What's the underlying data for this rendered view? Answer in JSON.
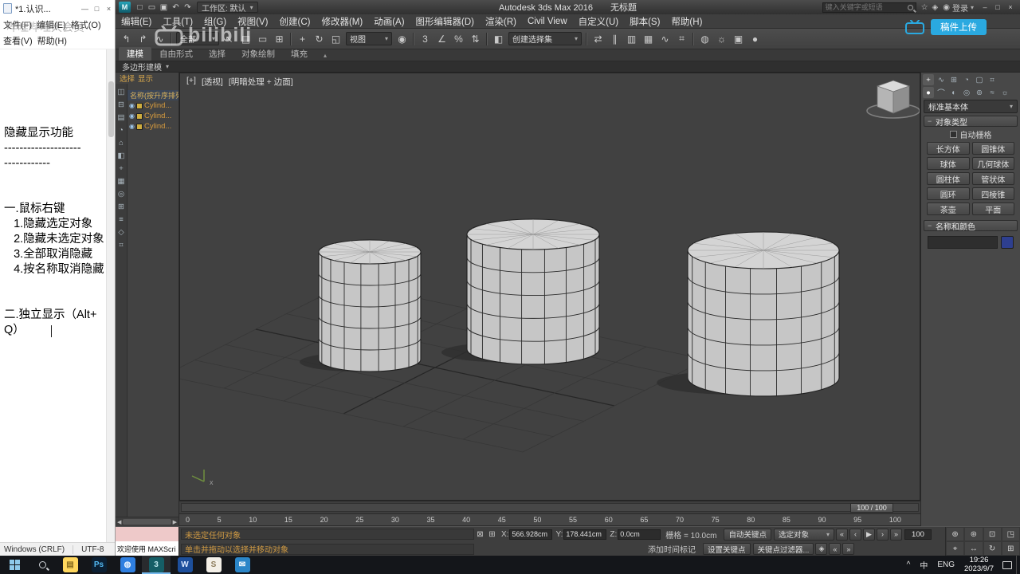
{
  "overlay": {
    "watermark_left": "哔哩哔哩大会员",
    "logo_text": "bilibili",
    "upload_label": "稿件上传",
    "brand_color": "#2aa9e0"
  },
  "notepad": {
    "title": "*1.认识...",
    "menus": [
      "文件(F)",
      "编辑(E)",
      "格式(O)",
      "查看(V)",
      "帮助(H)"
    ],
    "window_buttons": [
      {
        "n": "notepad-minimize-button",
        "g": "—"
      },
      {
        "n": "notepad-maximize-button",
        "g": "□"
      },
      {
        "n": "notepad-close-button",
        "g": "×"
      }
    ],
    "lines": [
      "",
      "",
      "隐藏显示功能",
      "--------------------",
      "------------",
      "",
      "",
      "一.鼠标右键",
      "   1.隐藏选定对象",
      "   2.隐藏未选定对象",
      "   3.全部取消隐藏",
      "   4.按名称取消隐藏",
      "",
      "",
      "二.独立显示（Alt+Q）"
    ],
    "status_left": "Windows (CRLF)",
    "status_right": "UTF-8"
  },
  "max": {
    "titlebar": {
      "workspace": "工作区: 默认",
      "app_title": "Autodesk 3ds Max 2016",
      "doc_title": "无标题",
      "search_placeholder": "键入关键字或短语",
      "signin": "登录",
      "quick_icons": [
        {
          "n": "new-file-icon",
          "g": "□"
        },
        {
          "n": "open-file-icon",
          "g": "▭"
        },
        {
          "n": "save-icon",
          "g": "▣"
        },
        {
          "n": "undo-icon",
          "g": "↶"
        },
        {
          "n": "redo-icon",
          "g": "↷"
        }
      ],
      "right_icons": [
        {
          "n": "favorites-star-icon",
          "g": "☆"
        },
        {
          "n": "infocenter-icon",
          "g": "◈"
        }
      ],
      "window_buttons": [
        {
          "n": "minimize-button",
          "g": "–"
        },
        {
          "n": "maximize-button",
          "g": "□"
        },
        {
          "n": "close-button",
          "g": "×"
        }
      ]
    },
    "menubar": [
      "编辑(E)",
      "工具(T)",
      "组(G)",
      "视图(V)",
      "创建(C)",
      "修改器(M)",
      "动画(A)",
      "图形编辑器(D)",
      "渲染(R)",
      "Civil View",
      "自定义(U)",
      "脚本(S)",
      "帮助(H)"
    ],
    "toolbar_items": [
      {
        "n": "select-link-icon",
        "g": "↰",
        "cls": "icon"
      },
      {
        "n": "unlink-icon",
        "g": "↱",
        "cls": "icon"
      },
      {
        "n": "bind-spacewarp-icon",
        "g": "∿",
        "cls": "icon"
      },
      {
        "n": "toolbar-separator",
        "cls": "sep"
      },
      {
        "n": "selection-filter-dropdown",
        "v": "全部",
        "cls": "drop d1"
      },
      {
        "n": "select-object-icon",
        "g": "↖",
        "cls": "icon"
      },
      {
        "n": "select-by-name-icon",
        "g": "▤",
        "cls": "icon"
      },
      {
        "n": "rect-region-icon",
        "g": "▭",
        "cls": "icon"
      },
      {
        "n": "window-crossing-icon",
        "g": "⊞",
        "cls": "icon"
      },
      {
        "n": "toolbar-separator",
        "cls": "sep"
      },
      {
        "n": "move-icon",
        "g": "+",
        "cls": "icon"
      },
      {
        "n": "rotate-icon",
        "g": "↻",
        "cls": "icon"
      },
      {
        "n": "scale-icon",
        "g": "◱",
        "cls": "icon"
      },
      {
        "n": "ref-coord-dropdown",
        "v": "视图",
        "cls": "drop d2"
      },
      {
        "n": "use-pivot-center-icon",
        "g": "◉",
        "cls": "icon"
      },
      {
        "n": "toolbar-separator",
        "cls": "sep"
      },
      {
        "n": "snap-toggle-icon",
        "g": "3",
        "cls": "icon"
      },
      {
        "n": "angle-snap-icon",
        "g": "∠",
        "cls": "icon"
      },
      {
        "n": "percent-snap-icon",
        "g": "%",
        "cls": "icon"
      },
      {
        "n": "spinner-snap-icon",
        "g": "⇅",
        "cls": "icon"
      },
      {
        "n": "toolbar-separator",
        "cls": "sep"
      },
      {
        "n": "edit-named-selections-icon",
        "g": "◧",
        "cls": "icon"
      },
      {
        "n": "named-selection-dropdown",
        "v": "创建选择集",
        "cls": "drop d3"
      },
      {
        "n": "toolbar-separator",
        "cls": "sep"
      },
      {
        "n": "mirror-icon",
        "g": "⇄",
        "cls": "icon"
      },
      {
        "n": "align-icon",
        "g": "∥",
        "cls": "icon"
      },
      {
        "n": "layer-manager-icon",
        "g": "▥",
        "cls": "icon"
      },
      {
        "n": "ribbon-toggle-icon",
        "g": "▦",
        "cls": "icon"
      },
      {
        "n": "curve-editor-icon",
        "g": "∿",
        "cls": "icon"
      },
      {
        "n": "schematic-view-icon",
        "g": "⌗",
        "cls": "icon"
      },
      {
        "n": "toolbar-separator",
        "cls": "sep"
      },
      {
        "n": "material-editor-icon",
        "g": "◍",
        "cls": "icon"
      },
      {
        "n": "render-setup-icon",
        "g": "☼",
        "cls": "icon"
      },
      {
        "n": "rendered-frame-icon",
        "g": "▣",
        "cls": "icon"
      },
      {
        "n": "render-production-icon",
        "g": "●",
        "cls": "icon"
      }
    ],
    "ribbon": {
      "tabs": [
        {
          "label": "建模",
          "active": true
        },
        {
          "label": "自由形式"
        },
        {
          "label": "选择"
        },
        {
          "label": "对象绘制"
        },
        {
          "label": "填充"
        }
      ],
      "subtab": "多边形建模"
    },
    "explorer": {
      "menu_select": "选择",
      "menu_display": "显示",
      "header": "名称(按升序排列)",
      "tools": [
        {
          "n": "explorer-pin-icon",
          "g": "◫"
        },
        {
          "n": "explorer-sort-icon",
          "g": "⊟"
        },
        {
          "n": "explorer-list-icon",
          "g": "▤"
        },
        {
          "n": "explorer-time-icon",
          "g": "◔"
        },
        {
          "n": "explorer-home-icon",
          "g": "⌂"
        },
        {
          "n": "explorer-filter-icon",
          "g": "◧"
        },
        {
          "n": "explorer-add-icon",
          "g": "+"
        },
        {
          "n": "explorer-grid-icon",
          "g": "▦"
        },
        {
          "n": "explorer-target-icon",
          "g": "◎"
        },
        {
          "n": "explorer-box-icon",
          "g": "⊞"
        },
        {
          "n": "explorer-rows-icon",
          "g": "≡"
        },
        {
          "n": "explorer-shape-icon",
          "g": "◇"
        },
        {
          "n": "explorer-hash-icon",
          "g": "⌗"
        }
      ],
      "items": [
        {
          "label": "Cylind..."
        },
        {
          "label": "Cylind..."
        },
        {
          "label": "Cylind..."
        }
      ]
    },
    "viewport": {
      "label_general": "[+]",
      "label_pov": "[透视]",
      "label_shading": "[明暗处理 + 边面]",
      "axis_label": "x"
    },
    "panel": {
      "tabs": [
        {
          "n": "tab-create",
          "g": "+",
          "active": true
        },
        {
          "n": "tab-modify",
          "g": "∿"
        },
        {
          "n": "tab-hierarchy",
          "g": "⊞"
        },
        {
          "n": "tab-motion",
          "g": "◔"
        },
        {
          "n": "tab-display",
          "g": "▢"
        },
        {
          "n": "tab-utilities",
          "g": "⌗"
        }
      ],
      "categories": [
        {
          "n": "category-geometry",
          "g": "●",
          "active": true
        },
        {
          "n": "category-shapes",
          "g": "⌒"
        },
        {
          "n": "category-lights",
          "g": "◐"
        },
        {
          "n": "category-cameras",
          "g": "◎"
        },
        {
          "n": "category-helpers",
          "g": "⊚"
        },
        {
          "n": "category-spacewarps",
          "g": "≈"
        },
        {
          "n": "category-systems",
          "g": "☼"
        }
      ],
      "category_dropdown": "标准基本体",
      "rollout_object_type": "对象类型",
      "autogrid_label": "自动栅格",
      "object_buttons": [
        "长方体",
        "圆锥体",
        "球体",
        "几何球体",
        "圆柱体",
        "管状体",
        "圆环",
        "四棱锥",
        "茶壶",
        "平面"
      ],
      "rollout_name_color": "名称和颜色",
      "name_value": "",
      "swatch_color": "#2e3f8f"
    },
    "trackbar": {
      "slider": "100 / 100"
    },
    "timeline": {
      "ticks": [
        "0",
        "5",
        "10",
        "15",
        "20",
        "25",
        "30",
        "35",
        "40",
        "45",
        "50",
        "55",
        "60",
        "65",
        "70",
        "75",
        "80",
        "85",
        "90",
        "95",
        "100"
      ]
    },
    "statusbar": {
      "listener_text": "欢迎使用 MAXScri",
      "status_line": "未选定任何对象",
      "prompt_line": "单击并拖动以选择并移动对象",
      "x_label": "X:",
      "y_label": "Y:",
      "z_label": "Z:",
      "x_value": "566.928cm",
      "y_value": "178.441cm",
      "z_value": "0.0cm",
      "grid_label": "栅格 = 10.0cm",
      "time_tag": "添加时间标记",
      "autokey": "自动关键点",
      "setkey": "设置关键点",
      "selset": "选定对象",
      "key_filters": "关键点过滤器...",
      "frame_value": "100",
      "playback1": [
        {
          "n": "go-start-button",
          "g": "«"
        },
        {
          "n": "prev-frame-button",
          "g": "‹"
        },
        {
          "n": "play-button",
          "g": "▶"
        },
        {
          "n": "next-frame-button",
          "g": "›"
        },
        {
          "n": "go-end-button",
          "g": "»"
        }
      ],
      "playback2": [
        {
          "n": "key-mode-button",
          "g": "◈"
        },
        {
          "n": "prev-key-button",
          "g": "«"
        },
        {
          "n": "next-key-button",
          "g": "»"
        }
      ],
      "nav": [
        {
          "n": "zoom-icon",
          "g": "⊕"
        },
        {
          "n": "zoom-all-icon",
          "g": "⊛"
        },
        {
          "n": "zoom-extents-icon",
          "g": "⊡"
        },
        {
          "n": "zoom-region-icon",
          "g": "◳"
        },
        {
          "n": "fov-icon",
          "g": "⌖"
        },
        {
          "n": "pan-icon",
          "g": "↔"
        },
        {
          "n": "orbit-icon",
          "g": "↻"
        },
        {
          "n": "maximize-viewport-icon",
          "g": "⊞"
        }
      ]
    }
  },
  "taskbar": {
    "apps": [
      {
        "n": "taskbar-file-explorer",
        "bg": "#ffd75e",
        "fg": "#8a6d1f",
        "g": "▤"
      },
      {
        "n": "taskbar-photoshop",
        "bg": "#0c1f33",
        "fg": "#53b9f2",
        "v": "Ps"
      },
      {
        "n": "taskbar-browser",
        "bg": "#2f7fe0",
        "fg": "#eaf4ff",
        "g": "◍"
      },
      {
        "n": "taskbar-3dsmax",
        "bg": "#155e66",
        "fg": "#bfe9ee",
        "v": "3",
        "active": true
      },
      {
        "n": "taskbar-word",
        "bg": "#1d4f9c",
        "fg": "#dce9ff",
        "v": "W"
      },
      {
        "n": "taskbar-sai",
        "bg": "#f3efe7",
        "fg": "#8c7b5a",
        "v": "S"
      },
      {
        "n": "taskbar-mail",
        "bg": "#2b86c8",
        "fg": "#ffffff",
        "g": "✉"
      }
    ],
    "tray_up": "^",
    "tray_ime": "中",
    "tray_lang": "ENG",
    "time": "19:26",
    "date": "2023/9/7"
  }
}
